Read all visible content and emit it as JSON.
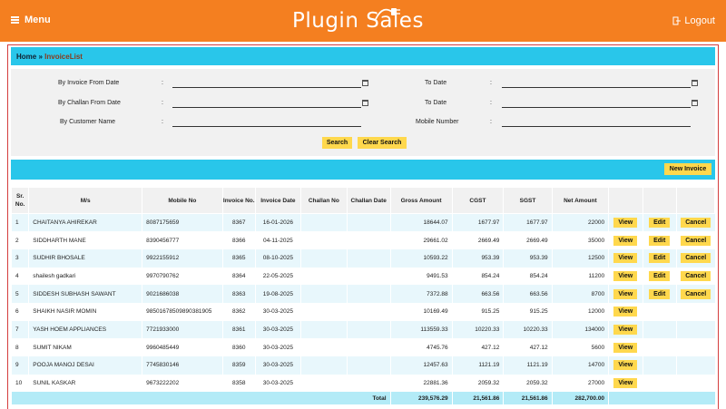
{
  "header": {
    "menu_label": "Menu",
    "brand_name": "Plugin Sales",
    "logout_label": "Logout"
  },
  "colors": {
    "header": "#f47f20",
    "accent": "#29c6ea",
    "button": "#ffd84d"
  },
  "breadcrumb": {
    "home": "Home",
    "sep": " » ",
    "current": "InvoiceList"
  },
  "filters": {
    "invoice_from_label": "By Invoice From Date",
    "to_date_label": "To Date",
    "challan_from_label": "By Challan From Date",
    "customer_name_label": "By Customer Name",
    "mobile_label": "Mobile Number",
    "colon": ":",
    "search_label": "Search",
    "clear_label": "Clear Search"
  },
  "toolbar": {
    "new_invoice_label": "New Invoice"
  },
  "table": {
    "headers": [
      "Sr. No.",
      "M/s",
      "Mobile No",
      "Invoice No.",
      "Invoice Date",
      "Challan No",
      "Challan Date",
      "Gross Amount",
      "CGST",
      "SGST",
      "Net Amount"
    ],
    "action_labels": {
      "view": "View",
      "edit": "Edit",
      "cancel": "Cancel"
    },
    "rows": [
      {
        "sr": "1",
        "ms": "CHAITANYA AHIREKAR",
        "mobile": "8087175659",
        "inv": "8367",
        "date": "16-01-2026",
        "gross": "18644.07",
        "cgst": "1677.97",
        "sgst": "1677.97",
        "net": "22000"
      },
      {
        "sr": "2",
        "ms": "SIDDHARTH MANE",
        "mobile": "8390456777",
        "inv": "8366",
        "date": "04-11-2025",
        "gross": "29661.02",
        "cgst": "2669.49",
        "sgst": "2669.49",
        "net": "35000"
      },
      {
        "sr": "3",
        "ms": "SUDHIR BHOSALE",
        "mobile": "9922155912",
        "inv": "8365",
        "date": "08-10-2025",
        "gross": "10593.22",
        "cgst": "953.39",
        "sgst": "953.39",
        "net": "12500"
      },
      {
        "sr": "4",
        "ms": "shailesh gadkari",
        "mobile": "9970790762",
        "inv": "8364",
        "date": "22-05-2025",
        "gross": "9491.53",
        "cgst": "854.24",
        "sgst": "854.24",
        "net": "11200"
      },
      {
        "sr": "5",
        "ms": "SIDDESH SUBHASH SAWANT",
        "mobile": "9021686038",
        "inv": "8363",
        "date": "19-08-2025",
        "gross": "7372.88",
        "cgst": "663.56",
        "sgst": "663.56",
        "net": "8700"
      },
      {
        "sr": "6",
        "ms": "SHAIKH NASIR MOMIN",
        "mobile": "9850167850989038190​5",
        "inv": "8362",
        "date": "30-03-2025",
        "gross": "10169.49",
        "cgst": "915.25",
        "sgst": "915.25",
        "net": "12000"
      },
      {
        "sr": "7",
        "ms": "YASH HOEM APPLIANCES",
        "mobile": "7721933000",
        "inv": "8361",
        "date": "30-03-2025",
        "gross": "113559.33",
        "cgst": "10220.33",
        "sgst": "10220.33",
        "net": "134000"
      },
      {
        "sr": "8",
        "ms": "SUMIT NIKAM",
        "mobile": "9960485449",
        "inv": "8360",
        "date": "30-03-2025",
        "gross": "4745.76",
        "cgst": "427.12",
        "sgst": "427.12",
        "net": "5600"
      },
      {
        "sr": "9",
        "ms": "POOJA MANOJ DESAI",
        "mobile": "7745830146",
        "inv": "8359",
        "date": "30-03-2025",
        "gross": "12457.63",
        "cgst": "1121.19",
        "sgst": "1121.19",
        "net": "14700"
      },
      {
        "sr": "10",
        "ms": "SUNIL KASKAR",
        "mobile": "9673222202",
        "inv": "8358",
        "date": "30-03-2025",
        "gross": "22881.36",
        "cgst": "2059.32",
        "sgst": "2059.32",
        "net": "27000"
      }
    ],
    "totals": {
      "label": "Total",
      "gross": "239,576.29",
      "cgst": "21,561.86",
      "sgst": "21,561.86",
      "net": "282,700.00"
    }
  }
}
